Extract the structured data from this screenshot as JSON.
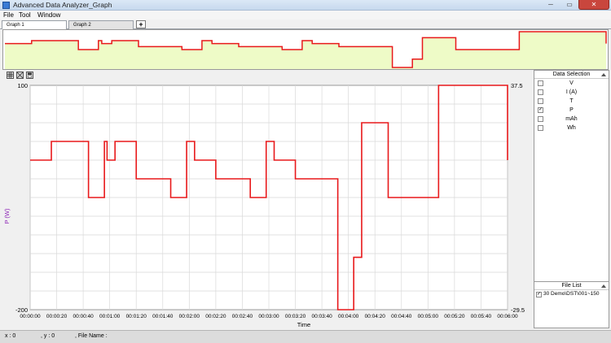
{
  "window": {
    "title": "Advanced Data Analyzer_Graph",
    "min_glyph": "─",
    "max_glyph": "▭",
    "close_glyph": "✕"
  },
  "menu": [
    "File",
    "Tool",
    "Window"
  ],
  "tabs": [
    {
      "label": "Graph 1",
      "active": true
    },
    {
      "label": "Graph 2",
      "active": false
    }
  ],
  "add_tab_label": "+",
  "toolbar_icons": [
    "grid-icon",
    "zoom-icon",
    "save-icon"
  ],
  "side_panel": {
    "data_selection_title": "Data Selection",
    "items": [
      {
        "label": "V",
        "checked": false
      },
      {
        "label": "I (A)",
        "checked": false
      },
      {
        "label": "T",
        "checked": false
      },
      {
        "label": "P",
        "checked": true
      },
      {
        "label": "mAh",
        "checked": false
      },
      {
        "label": "Wh",
        "checked": false
      }
    ],
    "file_list_title": "File List",
    "files": [
      {
        "label": "30 Demo\\DST\\001~150",
        "checked": true
      }
    ]
  },
  "status": {
    "x_text": "x : 0",
    "y_text": ", y : 0",
    "file_text": ", File Name :"
  },
  "colors": {
    "series": "#e8191b",
    "overview_bg": "#eefbc7",
    "grid": "#d9d9d9",
    "y_label": "#8a1fb5"
  },
  "chart_data": {
    "type": "line",
    "title": "",
    "xlabel": "Time",
    "ylabel": "P (W)",
    "left_axis_ticks": [
      "100",
      "-200"
    ],
    "right_axis_ticks": [
      "37.5",
      "-29.5"
    ],
    "ylim": [
      -200,
      100
    ],
    "y2lim": [
      -29.5,
      37.5
    ],
    "xlim": [
      0,
      360
    ],
    "grid": true,
    "legend": "none",
    "x_tick_labels": [
      "00:00:00",
      "00:00:20",
      "00:00:40",
      "00:01:00",
      "00:01:20",
      "00:01:40",
      "00:02:00",
      "00:02:20",
      "00:02:40",
      "00:03:00",
      "00:03:20",
      "00:03:40",
      "00:04:00",
      "00:04:20",
      "00:04:40",
      "00:05:00",
      "00:05:20",
      "00:05:40",
      "00:06:00"
    ],
    "series": [
      {
        "color": "#e8191b",
        "step_x": [
          0,
          16,
          44,
          56,
          58,
          64,
          80,
          106,
          118,
          124,
          140,
          166,
          178,
          184,
          200,
          232,
          244,
          250,
          270,
          308
        ],
        "step_y": [
          0,
          25,
          -50,
          25,
          0,
          25,
          -25,
          -50,
          25,
          0,
          -25,
          -50,
          25,
          0,
          -25,
          -200,
          -130,
          50,
          -50,
          100
        ],
        "x_end": 360,
        "y_end": 0
      }
    ]
  }
}
